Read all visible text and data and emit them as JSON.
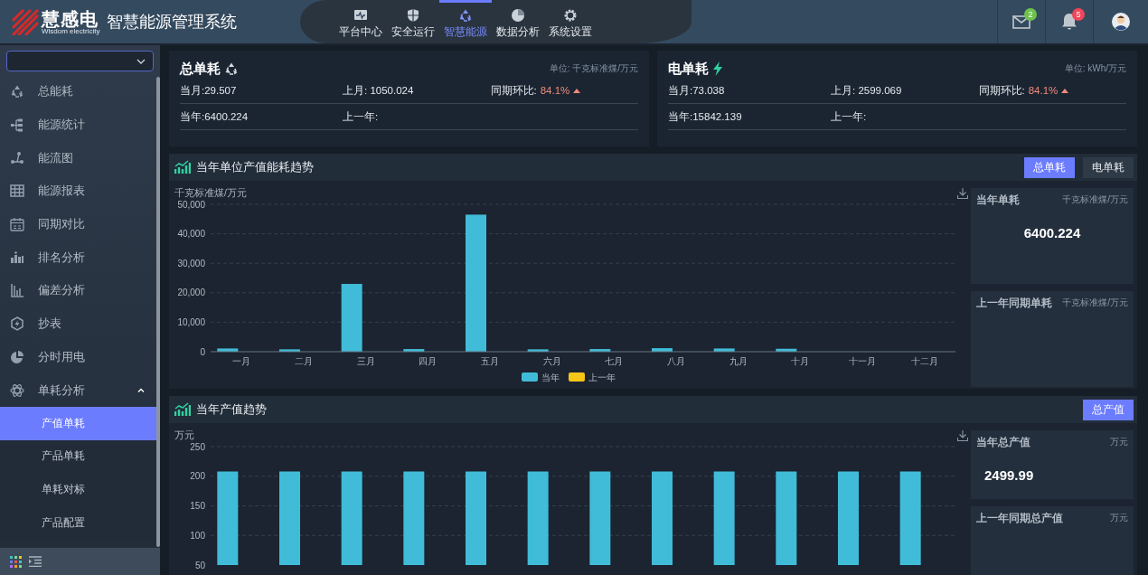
{
  "header": {
    "logo_text": "慧感电",
    "logo_subtitle": "Wisdom electricity",
    "title": "智慧能源管理系统",
    "nav": [
      {
        "label": "平台中心",
        "selected": false
      },
      {
        "label": "安全运行",
        "selected": false
      },
      {
        "label": "智慧能源",
        "selected": true
      },
      {
        "label": "数据分析",
        "selected": false
      },
      {
        "label": "系统设置",
        "selected": false
      }
    ],
    "mail_badge": "2",
    "alert_badge": "5"
  },
  "sidebar": {
    "items": [
      {
        "label": "总能耗",
        "selected": false
      },
      {
        "label": "能源统计",
        "selected": false
      },
      {
        "label": "能流图",
        "selected": false
      },
      {
        "label": "能源报表",
        "selected": false
      },
      {
        "label": "同期对比",
        "selected": false
      },
      {
        "label": "排名分析",
        "selected": false
      },
      {
        "label": "偏差分析",
        "selected": false
      },
      {
        "label": "抄表",
        "selected": false
      },
      {
        "label": "分时用电",
        "selected": false
      },
      {
        "label": "单耗分析",
        "selected": false,
        "expanded": true,
        "children": [
          {
            "label": "产值单耗",
            "selected": true
          },
          {
            "label": "产品单耗",
            "selected": false
          },
          {
            "label": "单耗对标",
            "selected": false
          },
          {
            "label": "产品配置",
            "selected": false
          }
        ]
      }
    ]
  },
  "summary_cards": [
    {
      "kind": "total",
      "title": "总单耗",
      "unit": "单位: 千克标准煤/万元",
      "rows": [
        [
          {
            "text": "当月:29.507"
          },
          {
            "text": "上月: 1050.024"
          },
          {
            "text": "同期环比:",
            "value": "84.1%",
            "rising": true
          }
        ],
        [
          {
            "text": "当年:6400.224"
          },
          {
            "text": "上一年:"
          }
        ]
      ]
    },
    {
      "kind": "electric",
      "title": "电单耗",
      "unit": "单位: kWh/万元",
      "rows": [
        [
          {
            "text": "当月:73.038"
          },
          {
            "text": "上月: 2599.069"
          },
          {
            "text": "同期环比:",
            "value": "84.1%",
            "rising": true
          }
        ],
        [
          {
            "text": "当年:15842.139"
          },
          {
            "text": "上一年:"
          }
        ]
      ]
    }
  ],
  "panels": [
    {
      "title": "当年单位产值能耗趋势",
      "buttons": [
        {
          "label": "总单耗",
          "selected": true
        },
        {
          "label": "电单耗",
          "selected": false
        }
      ],
      "chart_data": {
        "type": "bar",
        "grid": true,
        "ylabel": "千克标准煤/万元",
        "categories": [
          "一月",
          "二月",
          "三月",
          "四月",
          "五月",
          "六月",
          "七月",
          "八月",
          "九月",
          "十月",
          "十一月",
          "十二月"
        ],
        "series": [
          {
            "name": "当年",
            "color": "#40bcd8",
            "values": [
              1100,
              800,
              23000,
              900,
              46500,
              800,
              900,
              1200,
              1100,
              1000,
              null,
              null
            ]
          },
          {
            "name": "上一年",
            "color": "#f5c518",
            "values": [
              null,
              null,
              null,
              null,
              null,
              null,
              null,
              null,
              null,
              null,
              null,
              null
            ]
          }
        ],
        "ylim": [
          0,
          50000
        ],
        "yticks": [
          {
            "value": 0,
            "label": "0"
          },
          {
            "value": 10000,
            "label": "10,000"
          },
          {
            "value": 20000,
            "label": "20,000"
          },
          {
            "value": 30000,
            "label": "30,000"
          },
          {
            "value": 40000,
            "label": "40,000"
          },
          {
            "value": 50000,
            "label": "50,000"
          }
        ]
      },
      "side_cards": [
        {
          "title": "当年单耗",
          "unit": "千克标准煤/万元",
          "value": "6400.224"
        },
        {
          "title": "上一年同期单耗",
          "unit": "千克标准煤/万元"
        }
      ]
    },
    {
      "title": "当年产值趋势",
      "buttons": [
        {
          "label": "总产值",
          "selected": true
        }
      ],
      "chart_data": {
        "type": "bar",
        "grid": true,
        "ylabel": "万元",
        "values": [
          208,
          208,
          208,
          208,
          208,
          208,
          208,
          208,
          208,
          208,
          208,
          208
        ],
        "ylim": [
          50,
          250
        ],
        "yticks": [
          50,
          100,
          150,
          200,
          250
        ]
      },
      "side_cards": [
        {
          "title": "当年总产值",
          "unit": "万元",
          "value": "2499.99"
        },
        {
          "title": "上一年同期总产值",
          "unit": "万元"
        }
      ]
    }
  ]
}
